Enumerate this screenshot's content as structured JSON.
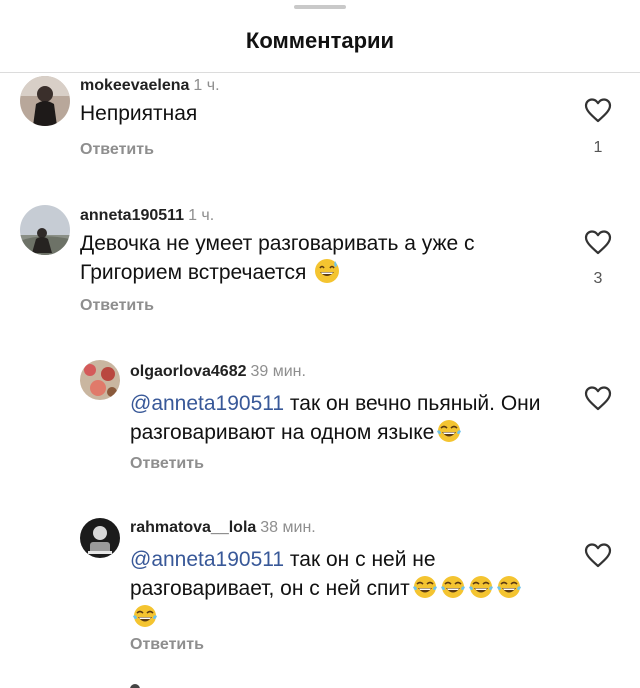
{
  "header": {
    "title": "Комментарии"
  },
  "comments": [
    {
      "username": "mokeevaelena",
      "time": "1 ч.",
      "text": "Неприятная",
      "reply_label": "Ответить",
      "likes": "1"
    },
    {
      "username": "anneta190511",
      "time": "1 ч.",
      "text": "Девочка не умеет разговаривать а уже с Григорием встречается",
      "reply_label": "Ответить",
      "likes": "3",
      "emoji": "sweat-smile-emoji"
    }
  ],
  "replies": [
    {
      "username": "olgaorlova4682",
      "time": "39 мин.",
      "mention": "@anneta190511",
      "text": " так он вечно пьяный. Они разговаривают на одном языке",
      "reply_label": "Ответить",
      "emoji": "tears-of-joy-emoji"
    },
    {
      "username": "rahmatova__lola",
      "time": "38 мин.",
      "mention": "@anneta190511",
      "text": " так он с ней не разговаривает,  он с ней спит",
      "reply_label": "Ответить",
      "emoji": "tears-of-joy-emoji"
    }
  ],
  "colors": {
    "mention": "#385898",
    "meta": "#8e8e8e",
    "emoji": "#f4c430"
  }
}
